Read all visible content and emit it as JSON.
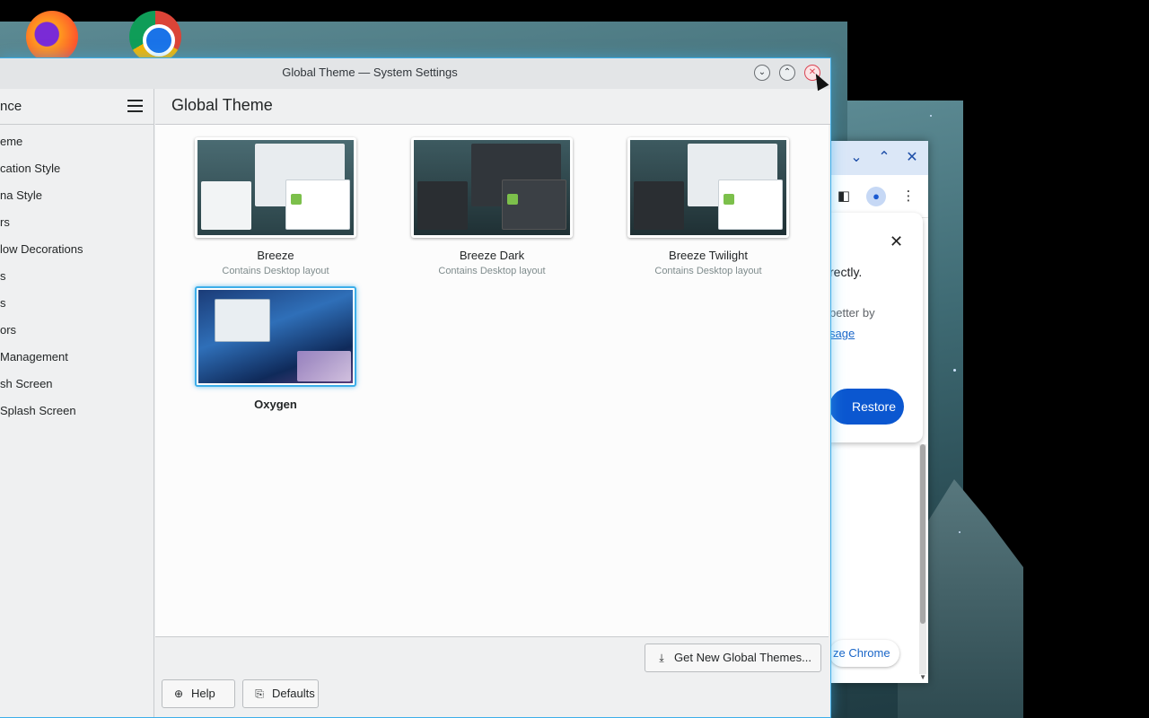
{
  "kde_window": {
    "title": "Global Theme — System Settings",
    "sidebar": {
      "header": "nce",
      "items": [
        "eme",
        "cation Style",
        "na Style",
        "rs",
        "low Decorations",
        "s",
        "s",
        "ors",
        "Management",
        "sh Screen",
        "Splash Screen"
      ]
    },
    "main": {
      "title": "Global Theme",
      "themes": [
        {
          "name": "Breeze",
          "subtitle": "Contains Desktop layout"
        },
        {
          "name": "Breeze Dark",
          "subtitle": "Contains Desktop layout"
        },
        {
          "name": "Breeze Twilight",
          "subtitle": "Contains Desktop layout"
        },
        {
          "name": "Oxygen",
          "subtitle": "",
          "selected": true
        }
      ],
      "get_new_label": "Get New Global Themes...",
      "help_label": "Help",
      "defaults_label": "Defaults"
    },
    "accent_color": "#3daee9"
  },
  "chrome_window": {
    "popup_text_1": "rectly.",
    "popup_text_2": "better by",
    "popup_link": "sage",
    "restore_label": "Restore",
    "customize_label": "ze Chrome"
  },
  "dock": {
    "icons": [
      "firefox-icon",
      "chrome-icon"
    ]
  }
}
